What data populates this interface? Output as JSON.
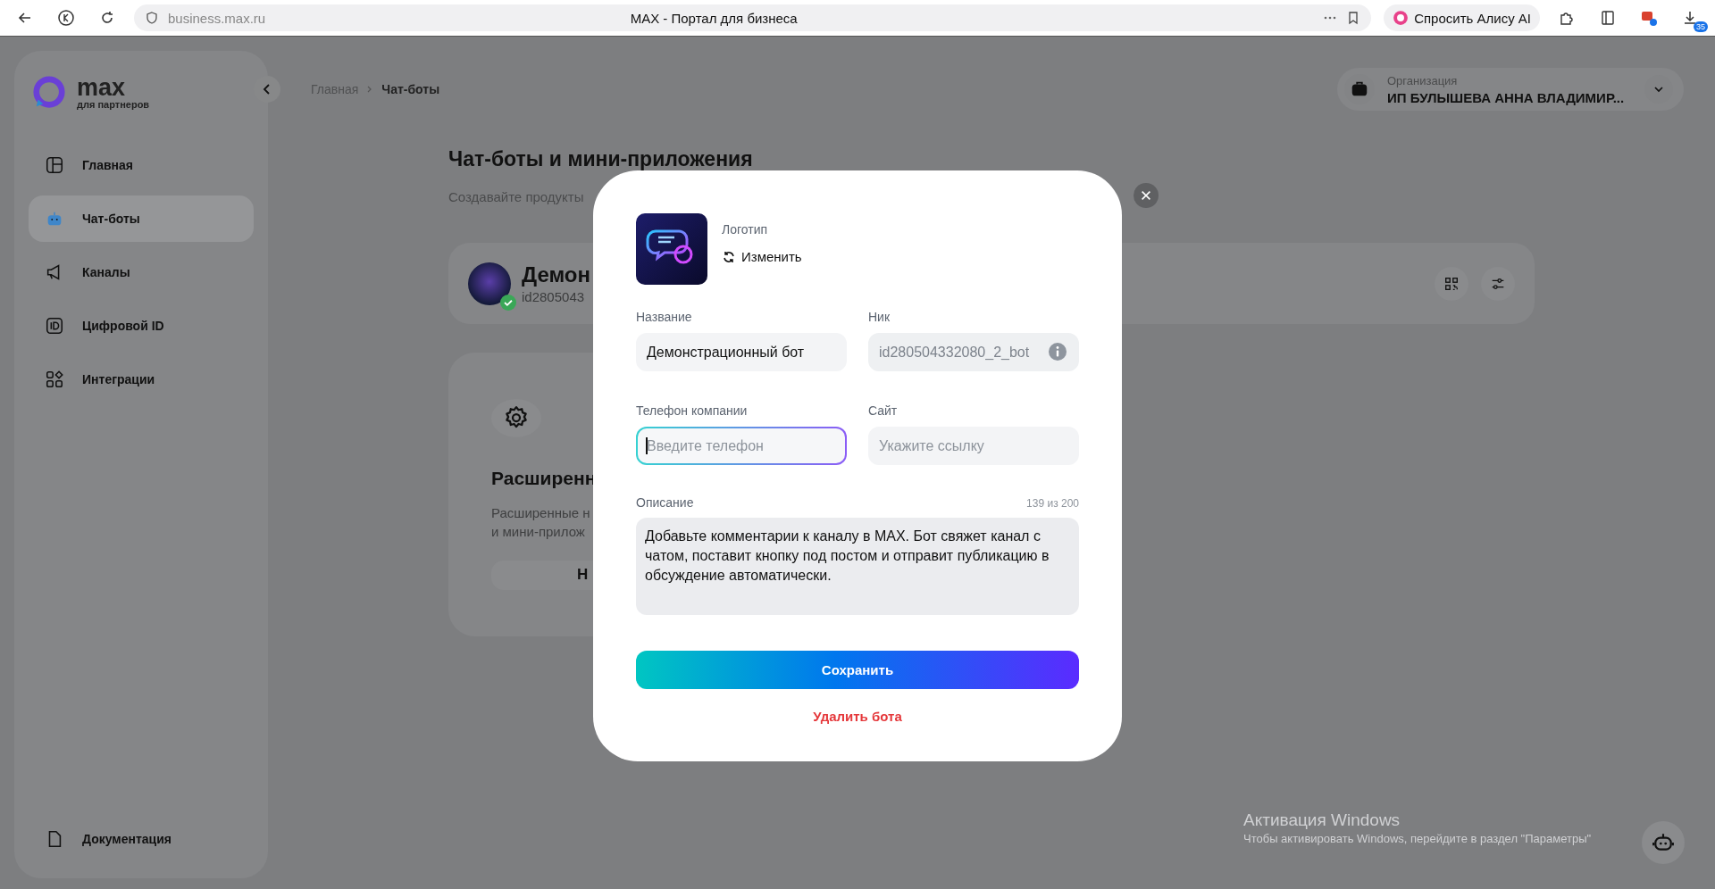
{
  "browser": {
    "url": "business.max.ru",
    "title": "MAX - Портал для бизнеса",
    "assistant_button": "Спросить Алису AI",
    "downloads_badge": "35"
  },
  "sidebar": {
    "logo_text": "max",
    "logo_subtitle": "для партнеров",
    "items": [
      {
        "label": "Главная",
        "selected": false
      },
      {
        "label": "Чат-боты",
        "selected": true
      },
      {
        "label": "Каналы",
        "selected": false
      },
      {
        "label": "Цифровой ID",
        "selected": false
      },
      {
        "label": "Интеграции",
        "selected": false
      }
    ],
    "footer_item": "Документация"
  },
  "breadcrumb": [
    "Главная",
    "Чат-боты"
  ],
  "organization": {
    "label": "Организация",
    "value": "ИП БУЛЫШЕВА АННА ВЛАДИМИР..."
  },
  "page": {
    "title": "Чат-боты и мини-приложения",
    "subtitle": "Создавайте продукты"
  },
  "bot_card": {
    "name": "Демон",
    "id": "id2805043",
    "verified": true
  },
  "feature_card": {
    "title": "Расширенн",
    "description_lines": [
      "Расширенные н",
      "и мини-прилож"
    ],
    "button": "Н"
  },
  "modal": {
    "logo_label": "Логотип",
    "change_button": "Изменить",
    "fields": [
      {
        "label": "Название",
        "value": "Демонстрационный бот",
        "disabled": false,
        "focused": false,
        "info": false
      },
      {
        "label": "Ник",
        "value": "id280504332080_2_bot",
        "disabled": true,
        "focused": false,
        "info": true
      },
      {
        "label": "Телефон компании",
        "placeholder": "Введите телефон",
        "disabled": false,
        "focused": true,
        "info": false
      },
      {
        "label": "Сайт",
        "placeholder": "Укажите ссылку",
        "disabled": false,
        "focused": false,
        "info": false
      }
    ],
    "description": {
      "label": "Описание",
      "counter": "139 из 200",
      "value": "Добавьте комментарии к каналу в MAX. Бот свяжет канал с чатом, поставит кнопку под постом и отправит публикацию в обсуждение автоматически."
    },
    "save_button": "Сохранить",
    "delete_button": "Удалить бота"
  },
  "os_notice": {
    "title": "Активация Windows",
    "text": "Чтобы активировать Windows, перейдите в раздел \"Параметры\""
  }
}
